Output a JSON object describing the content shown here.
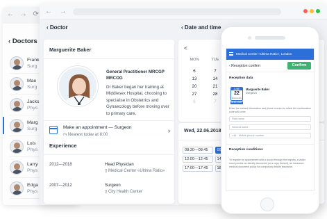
{
  "back_window": {
    "title": "Doctors",
    "doctors": [
      {
        "name": "Frank",
        "spec": "Surg"
      },
      {
        "name": "Mae",
        "spec": "Surg"
      },
      {
        "name": "Jacks",
        "spec": "Phys"
      },
      {
        "name": "Marg",
        "spec": "Surg"
      },
      {
        "name": "Lois",
        "spec": "Phys"
      },
      {
        "name": "Larry",
        "spec": "Phys"
      },
      {
        "name": "Edga",
        "spec": "Phys"
      }
    ]
  },
  "main_window": {
    "doctor_header": "Doctor",
    "doctor_name": "Marguerite Baker",
    "title_line": "General Practitioner MRCGP MRCOG",
    "bio": "Dr Baker began her training at Middlesex Hospital, choosing to specialise in Obstetrics and Gynaecology before moving over to primary care.",
    "appointment_title": "Make an appointment — Surgeon",
    "appointment_sub": "Nearest today at 8:00",
    "experience_title": "Experience",
    "experience": [
      {
        "years": "2012—2018",
        "position": "Head Physician",
        "org": "Medical Center «Ultima Ratio»"
      },
      {
        "years": "2007—2012",
        "position": "Surgeon",
        "org": "City Health Center"
      }
    ],
    "date_header": "Date and time",
    "calendar": {
      "nav": "<",
      "weekdays": [
        "MON",
        "TUE",
        "",
        ""
      ],
      "rows": [
        [
          "",
          "",
          "",
          ""
        ],
        [
          "6",
          "7",
          "",
          ""
        ],
        [
          "13",
          "14",
          "",
          ""
        ],
        [
          "20",
          "21",
          "",
          ""
        ],
        [
          "27",
          "28",
          "",
          ""
        ],
        [
          "6",
          "7",
          "",
          ""
        ]
      ]
    },
    "selected_date": "Wed, 22.06.2018",
    "slots": [
      "08:30—08:45",
      "09:00—",
      "12:00—12:45",
      "14:00—",
      "17:00—17:45",
      "18:00—"
    ]
  },
  "phone": {
    "appbar": "Medical Center «Ultima Ratio», London",
    "back_label": "Reception confirm",
    "confirm_label": "Confirm",
    "reception_data": "Reception data",
    "date_month": "JUNE",
    "date_day": "22",
    "date_weekday": "Wednesday",
    "date_time": "08:30—08:45",
    "doctor_name": "Marguerite Baker",
    "doctor_spec": "Surgeon",
    "instructions": "Enter the contact information and phone number to which the confirmation code will come.",
    "first_name_ph": "First name",
    "second_name_ph": "Second name",
    "phone_ph": "+44 · Mobile phone number",
    "conditions_title": "Reception conditions",
    "conditions_text": "To register an appointment with a doctor through the registry, a visitor must provide an identity document (or a copy thereof), an insurance medical document policy for compulsory health insurance."
  },
  "colors": {
    "accent": "#2d6fd8",
    "confirm": "#3cb371"
  }
}
